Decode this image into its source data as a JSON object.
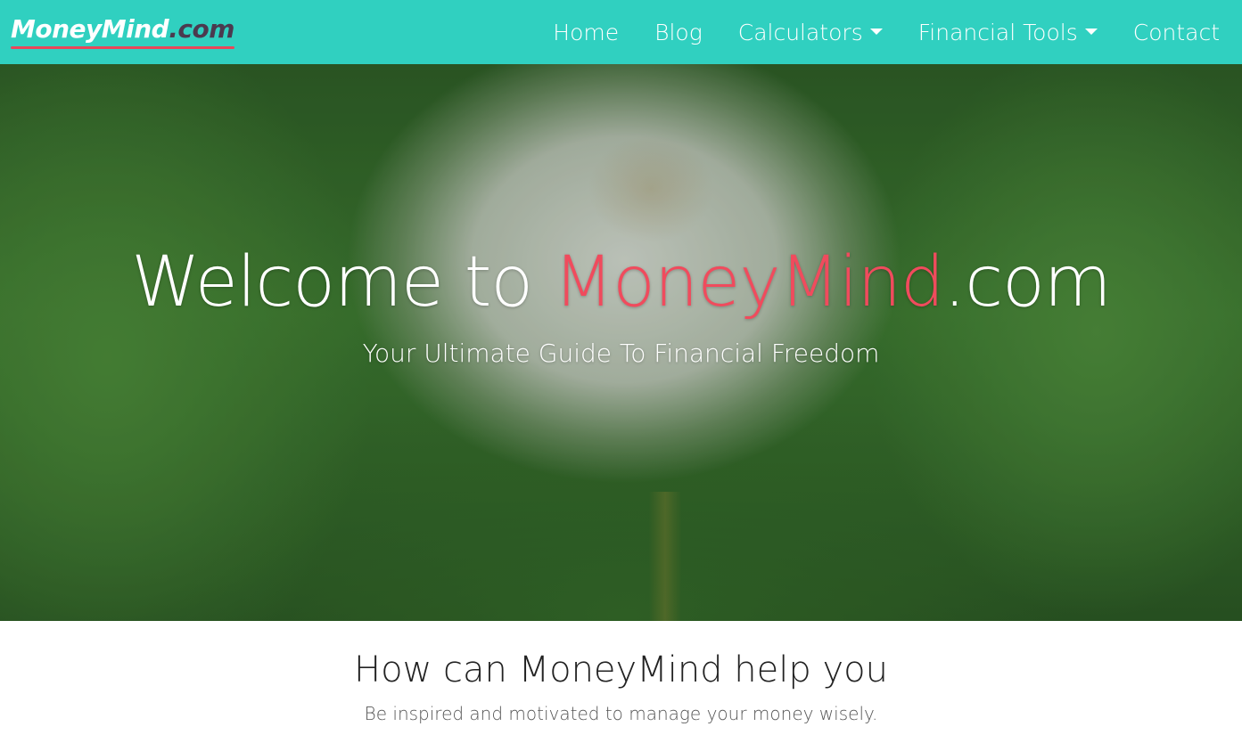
{
  "navbar": {
    "brand_name": "MoneyMind",
    "brand_tld": ".com",
    "items": [
      {
        "label": "Home"
      },
      {
        "label": "Blog"
      },
      {
        "label": "Calculators"
      },
      {
        "label": "Financial Tools"
      },
      {
        "label": "Contact"
      }
    ]
  },
  "hero": {
    "title_prefix": "Welcome to ",
    "title_accent": "MoneyMind",
    "title_suffix": ".com",
    "subtitle": "Your Ultimate Guide To Financial Freedom"
  },
  "intro": {
    "heading": "How can MoneyMind help you",
    "text": "Be inspired and motivated to manage your money wisely."
  },
  "colors": {
    "navbar_bg": "#30d0c0",
    "accent": "#f04b5d",
    "brand_tld": "#4b3a4f"
  },
  "icons": {
    "dropdown": "caret-down-icon"
  }
}
